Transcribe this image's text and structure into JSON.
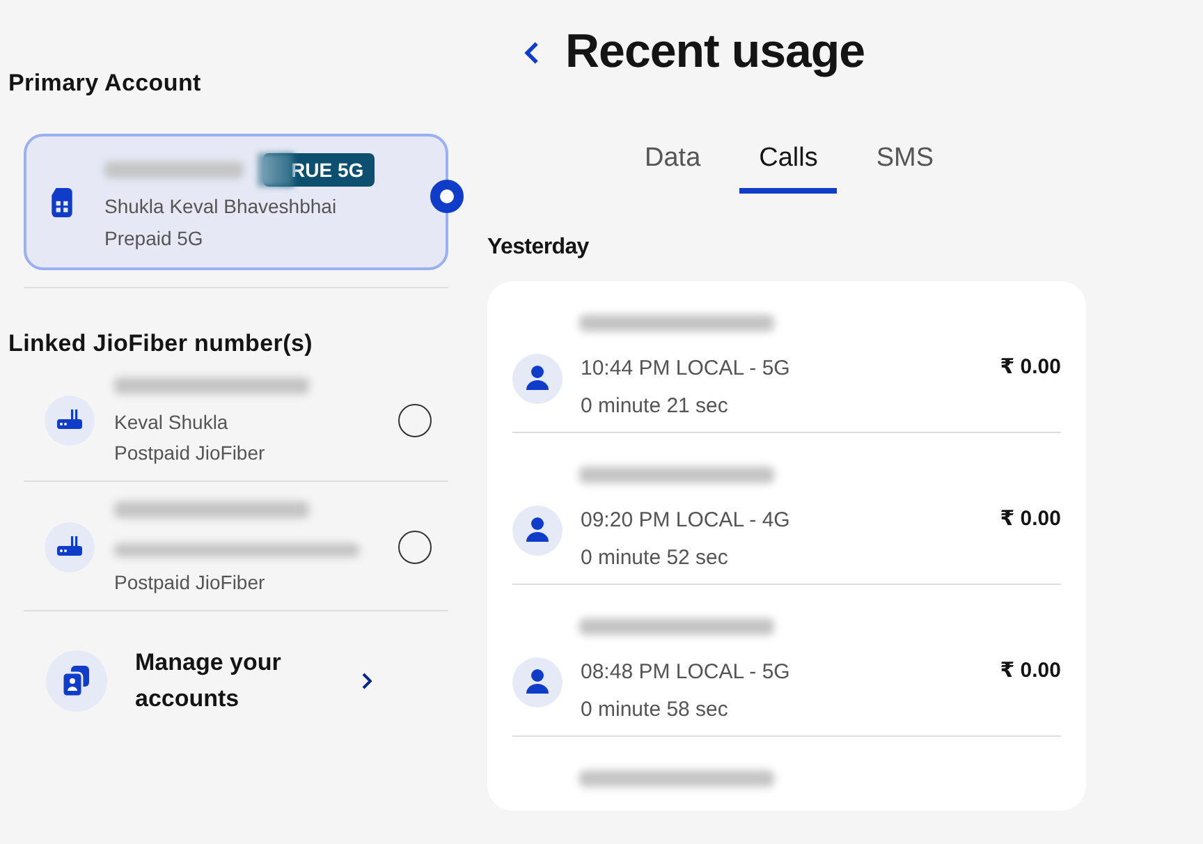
{
  "sidebar": {
    "primary_heading": "Primary Account",
    "primary_account": {
      "badge": "RUE 5G",
      "name": "Shukla Keval Bhaveshbhai",
      "plan": "Prepaid 5G",
      "selected": true
    },
    "linked_heading": "Linked JioFiber number(s)",
    "linked_accounts": [
      {
        "name": "Keval Shukla",
        "plan": "Postpaid JioFiber",
        "selected": false
      },
      {
        "plan": "Postpaid JioFiber",
        "selected": false
      }
    ],
    "manage_link": "Manage your accounts"
  },
  "header": {
    "title": "Recent usage"
  },
  "tabs": [
    {
      "label": "Data",
      "selected": false
    },
    {
      "label": "Calls",
      "selected": true
    },
    {
      "label": "SMS",
      "selected": false
    }
  ],
  "day_heading": "Yesterday",
  "calls": [
    {
      "time": "10:44 PM LOCAL - 5G",
      "duration": "0 minute 21 sec",
      "amount": "₹ 0.00"
    },
    {
      "time": "09:20 PM LOCAL - 4G",
      "duration": "0 minute 52 sec",
      "amount": "₹ 0.00"
    },
    {
      "time": "08:48 PM LOCAL - 5G",
      "duration": "0 minute 58 sec",
      "amount": "₹ 0.00"
    }
  ]
}
